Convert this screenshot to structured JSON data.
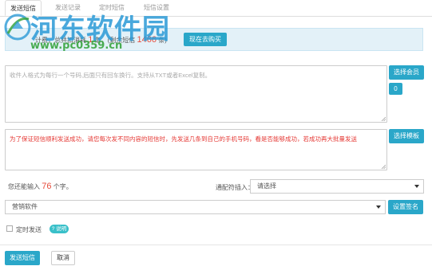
{
  "tabs": [
    {
      "label": "发送短信",
      "active": true
    },
    {
      "label": "发送记录",
      "active": false
    },
    {
      "label": "定时短信",
      "active": false
    },
    {
      "label": "短信设置",
      "active": false
    }
  ],
  "watermark": {
    "title": "河东软件园",
    "url": "www.pc0359.cn"
  },
  "info": {
    "prefix": "计费，总共扣消耗",
    "used_count": "1",
    "mid": "条，(剩余短信",
    "remaining_count": "1466",
    "suffix": "条)",
    "buy_button": "现在去购买"
  },
  "recipients": {
    "placeholder": "收件人格式为每行一个号码,后面只有回车换行。支持从TXT或者Excel复制。",
    "select_member_button": "选择会员",
    "count_badge": "0"
  },
  "message": {
    "text": "为了保证短信顺利发送成功，请您每次发不同内容的短信时，先发送几条到自己的手机号码，看是否能够成功，若成功再大批量发送",
    "select_template_button": "选择模板"
  },
  "remaining": {
    "prefix": "您还能输入",
    "count": "76",
    "suffix": "个字。"
  },
  "wildcard": {
    "label": "通配符插入：",
    "value": "请选择"
  },
  "signature": {
    "value": "营销软件",
    "button": "设置签名"
  },
  "schedule": {
    "label": "定时发送",
    "help": "? 说明"
  },
  "actions": {
    "send": "发送短信",
    "cancel": "取消"
  },
  "colors": {
    "accent": "#2aa7c9",
    "warning_text": "#e53935",
    "info_bg": "#e3f1f8"
  }
}
